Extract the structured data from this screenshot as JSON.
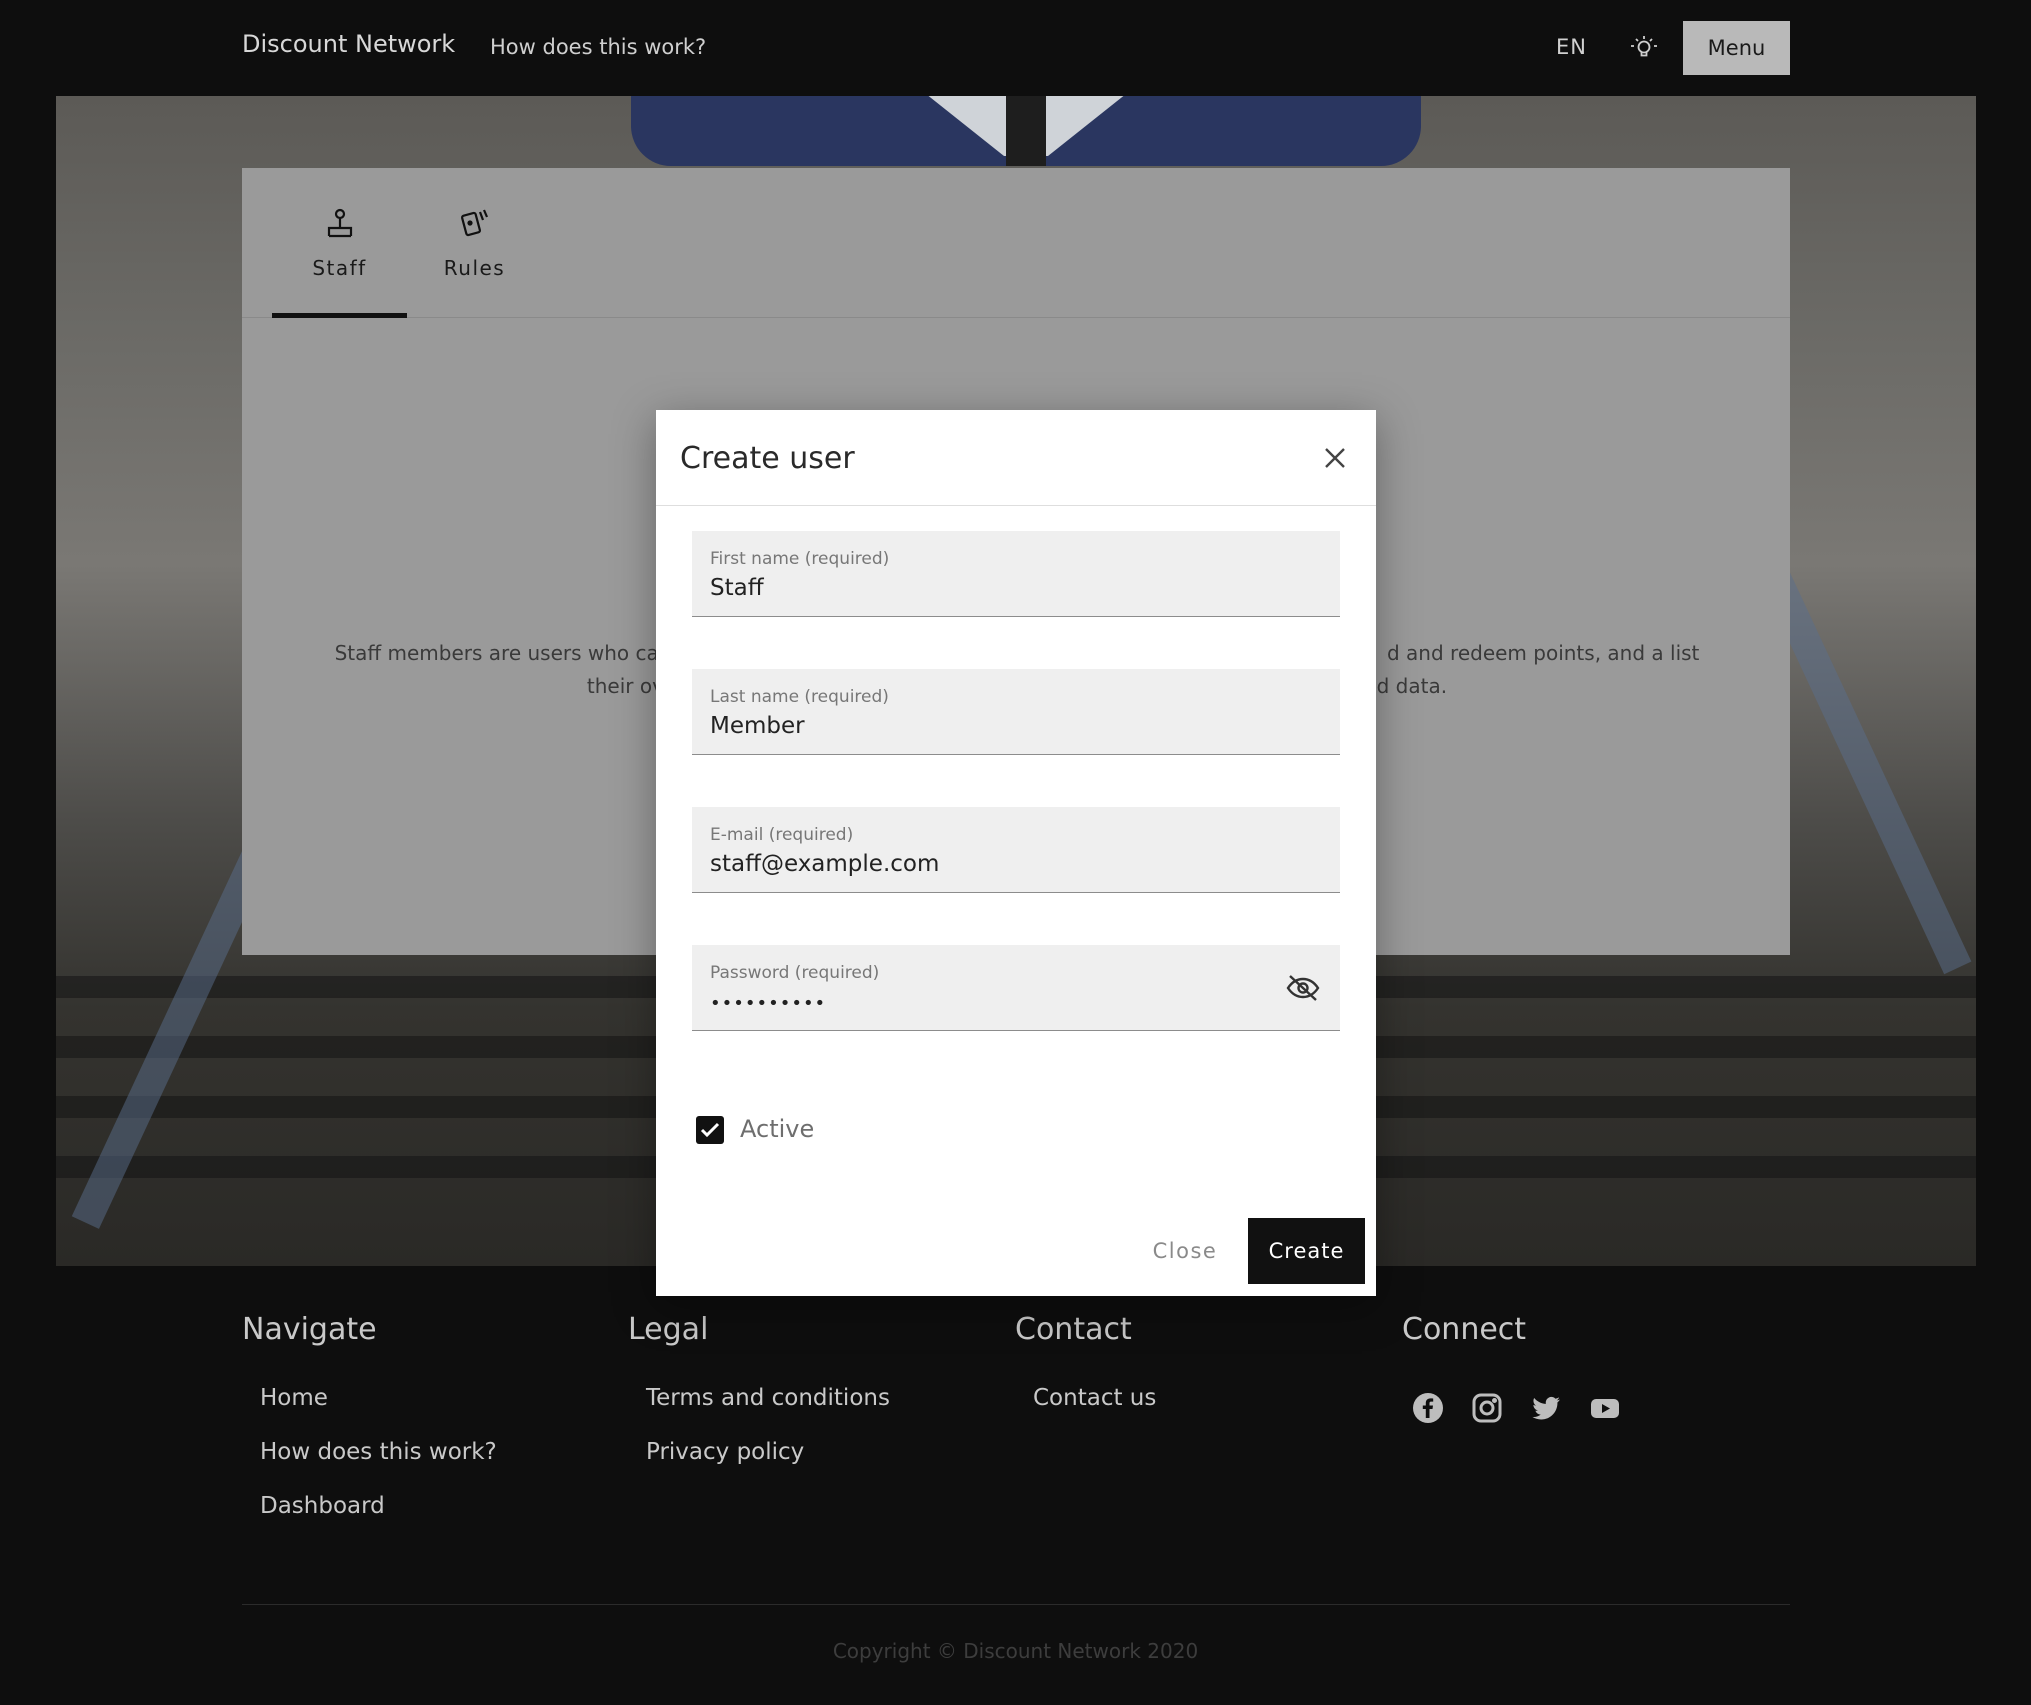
{
  "header": {
    "brand": "Discount Network",
    "how_link": "How does this work?",
    "language": "EN",
    "theme_icon": "lightbulb-icon",
    "menu_label": "Menu"
  },
  "card": {
    "tabs": [
      {
        "label": "Staff",
        "icon": "staff-icon",
        "selected": true
      },
      {
        "label": "Rules",
        "icon": "rules-icon",
        "selected": false
      }
    ],
    "description_line1_left": "Staff members are users who car",
    "description_line1_right": "d and redeem points, and a list of",
    "description_line2_left": "their ov",
    "description_line2_right": "nd data."
  },
  "modal": {
    "title": "Create user",
    "fields": {
      "first_name": {
        "label": "First name (required)",
        "value": "Staff"
      },
      "last_name": {
        "label": "Last name (required)",
        "value": "Member"
      },
      "email": {
        "label": "E-mail (required)",
        "value": "staff@example.com"
      },
      "password": {
        "label": "Password (required)",
        "value": "••••••••••"
      }
    },
    "active": {
      "label": "Active",
      "checked": true
    },
    "close_label": "Close",
    "create_label": "Create"
  },
  "footer": {
    "navigate": {
      "heading": "Navigate",
      "links": [
        "Home",
        "How does this work?",
        "Dashboard"
      ]
    },
    "legal": {
      "heading": "Legal",
      "links": [
        "Terms and conditions",
        "Privacy policy"
      ]
    },
    "contact": {
      "heading": "Contact",
      "links": [
        "Contact us"
      ]
    },
    "connect": {
      "heading": "Connect",
      "icons": [
        "facebook-icon",
        "instagram-icon",
        "twitter-icon",
        "youtube-icon"
      ]
    },
    "copyright": "Copyright © Discount Network 2020"
  },
  "colors": {
    "accent": "#111111",
    "footer_bg": "#0e0e0e",
    "menu_bg": "#b9b9b9"
  }
}
